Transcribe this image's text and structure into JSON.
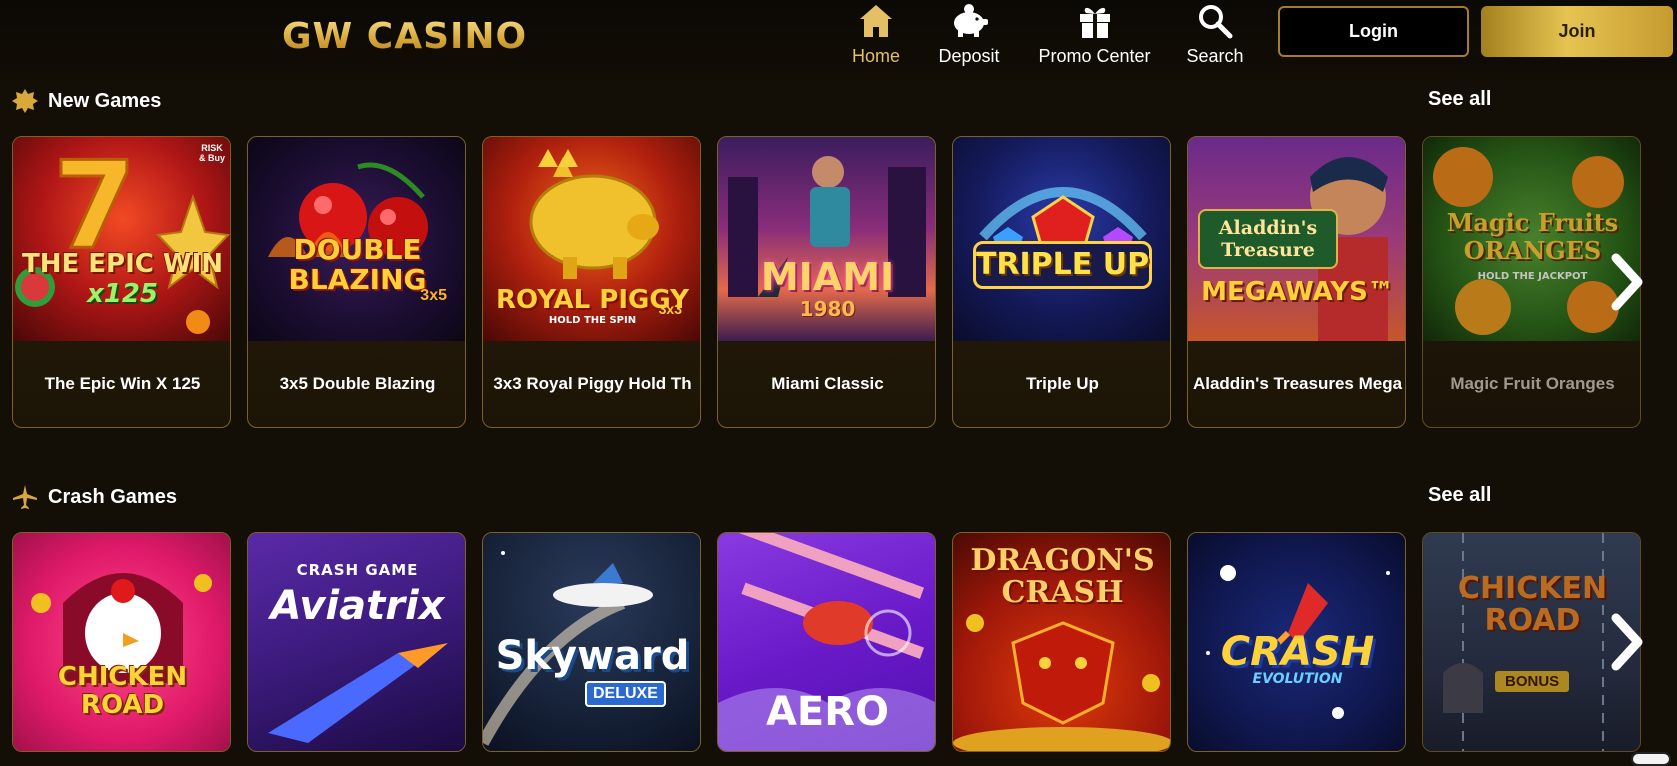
{
  "header": {
    "logo_text": "GW CASINO",
    "nav": [
      {
        "label": "Home",
        "icon": "home-icon",
        "active": true
      },
      {
        "label": "Deposit",
        "icon": "piggy-bank-icon",
        "active": false
      },
      {
        "label": "Promo Center",
        "icon": "gift-icon",
        "active": false
      },
      {
        "label": "Search",
        "icon": "search-icon",
        "active": false
      }
    ],
    "login_label": "Login",
    "join_label": "Join"
  },
  "sections": [
    {
      "title": "New Games",
      "icon": "sparkle-badge-icon",
      "see_all": "See all",
      "games": [
        {
          "name": "The Epic Win X 125",
          "art_title": "THE EPIC WIN",
          "art_sub": "x125",
          "art_badge": "RISK & Buy"
        },
        {
          "name": "3x5 Double Blazing",
          "art_title": "DOUBLE BLAZING",
          "art_sub": "3x5"
        },
        {
          "name": "3x3 Royal Piggy Hold Th",
          "art_title": "ROYAL PIGGY",
          "art_sub": "HOLD THE SPIN",
          "art_badge": "3x3"
        },
        {
          "name": "Miami Classic",
          "art_title": "MIAMI",
          "art_sub": "1980"
        },
        {
          "name": "Triple Up",
          "art_title": "TRIPLE UP"
        },
        {
          "name": "Aladdin's Treasures Mega",
          "art_title": "Aladdin's Treasure",
          "art_sub": "MEGAWAYS™"
        },
        {
          "name": "Magic Fruit Oranges",
          "art_title": "Magic Fruits ORANGES",
          "art_sub": "HOLD THE JACKPOT"
        }
      ]
    },
    {
      "title": "Crash Games",
      "icon": "airplane-icon",
      "see_all": "See all",
      "games": [
        {
          "art_title": "CHICKEN ROAD"
        },
        {
          "art_title": "Aviatrix",
          "art_sub": "CRASH GAME"
        },
        {
          "art_title": "Skyward",
          "art_sub": "DELUXE"
        },
        {
          "art_title": "AERO"
        },
        {
          "art_title": "DRAGON'S CRASH"
        },
        {
          "art_title": "CRASH",
          "art_sub": "EVOLUTION"
        },
        {
          "art_title": "CHICKEN ROAD",
          "art_sub": "BONUS"
        }
      ]
    }
  ],
  "colors": {
    "gold": "#e3c065",
    "background": "#140f06",
    "card_border": "#7d6128"
  }
}
